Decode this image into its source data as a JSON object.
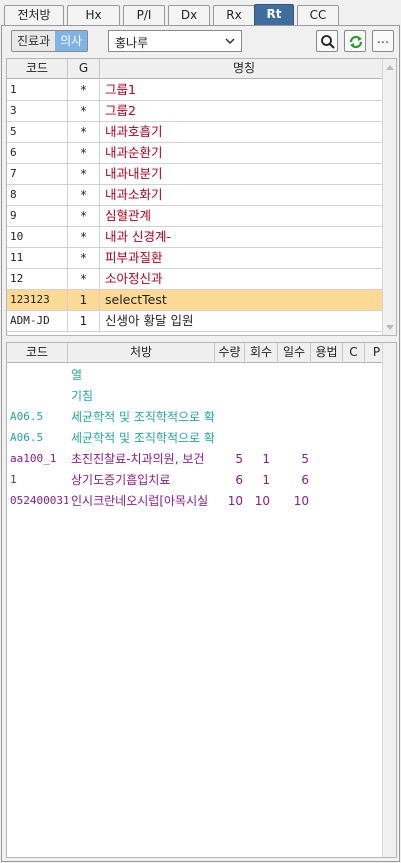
{
  "tabs": [
    {
      "label": "전처방"
    },
    {
      "label": "Hx"
    },
    {
      "label": "P/I"
    },
    {
      "label": "Dx"
    },
    {
      "label": "Rx"
    },
    {
      "label": "Rt"
    },
    {
      "label": "CC"
    }
  ],
  "toolbar": {
    "seg_left": "진료과",
    "seg_right": "의사",
    "doctor_value": "홍나루",
    "more_label": "..."
  },
  "upper_grid": {
    "headers": {
      "code": "코드",
      "g": "G",
      "name": "명칭"
    },
    "rows": [
      {
        "code": "1",
        "g": "*",
        "name": "그룹1"
      },
      {
        "code": "3",
        "g": "*",
        "name": "그룹2"
      },
      {
        "code": "5",
        "g": "*",
        "name": "내과호흡기"
      },
      {
        "code": "6",
        "g": "*",
        "name": "내과순환기"
      },
      {
        "code": "7",
        "g": "*",
        "name": "내과내분기"
      },
      {
        "code": "8",
        "g": "*",
        "name": "내과소화기"
      },
      {
        "code": "9",
        "g": "*",
        "name": "심혈관계"
      },
      {
        "code": "10",
        "g": "*",
        "name": "내과 신경계-"
      },
      {
        "code": "11",
        "g": "*",
        "name": "피부과질환"
      },
      {
        "code": "12",
        "g": "*",
        "name": "소아정신과"
      },
      {
        "code": "123123",
        "g": "1",
        "name": "selectTest"
      },
      {
        "code": "ADM-JD",
        "g": "1",
        "name": "신생아 황달 입원"
      }
    ]
  },
  "lower_grid": {
    "headers": {
      "code": "코드",
      "rx": "처방",
      "qty": "수량",
      "times": "회수",
      "days": "일수",
      "method": "용법",
      "c": "C",
      "p": "P"
    },
    "rows": [
      {
        "code": "",
        "rx": "열",
        "qty": "",
        "times": "",
        "days": "",
        "color": "teal"
      },
      {
        "code": "",
        "rx": "기침",
        "qty": "",
        "times": "",
        "days": "",
        "color": "teal"
      },
      {
        "code": "A06.5",
        "rx": "세균학적 및 조직학적으로 확인된 후두, 기관 및 기관",
        "qty": "",
        "times": "",
        "days": "",
        "color": "teal"
      },
      {
        "code": "A06.5",
        "rx": "세균학적 및 조직학적으로 확인된 가슴내 림프절의 결",
        "qty": "",
        "times": "",
        "days": "",
        "color": "teal"
      },
      {
        "code": "aa100_1",
        "rx": "초진진찰료-치과의원, 보건",
        "qty": "5",
        "times": "1",
        "days": "5",
        "color": "purple"
      },
      {
        "code": "1",
        "rx": "상기도증기흡입치료",
        "qty": "6",
        "times": "1",
        "days": "6",
        "color": "purple"
      },
      {
        "code": "052400031",
        "rx": "인시크란네오시럽[아목시실",
        "qty": "10",
        "times": "10",
        "days": "10",
        "color": "purple"
      }
    ]
  },
  "colors": {
    "active_tab": "#3f6d9e",
    "selected_row": "#fcd995",
    "group_text": "#b1001c",
    "teal": "#22a6a2",
    "purple": "#8a1c8a"
  }
}
